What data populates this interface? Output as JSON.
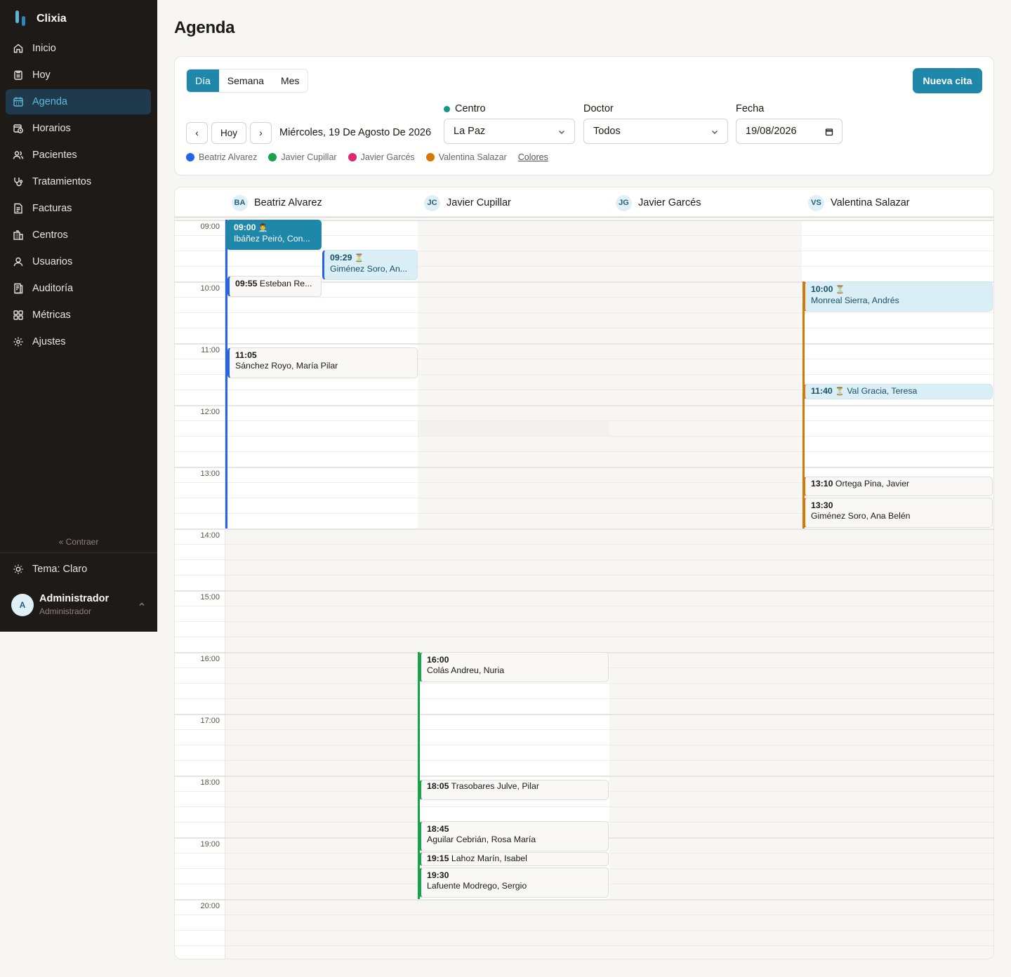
{
  "app": {
    "name": "Clixia"
  },
  "sidebar": {
    "items": [
      {
        "label": "Inicio",
        "icon": "home-icon"
      },
      {
        "label": "Hoy",
        "icon": "clipboard-icon"
      },
      {
        "label": "Agenda",
        "icon": "calendar-icon",
        "active": true
      },
      {
        "label": "Horarios",
        "icon": "schedule-icon"
      },
      {
        "label": "Pacientes",
        "icon": "users-icon"
      },
      {
        "label": "Tratamientos",
        "icon": "stethoscope-icon"
      },
      {
        "label": "Facturas",
        "icon": "invoice-icon"
      },
      {
        "label": "Centros",
        "icon": "building-icon"
      },
      {
        "label": "Usuarios",
        "icon": "user-icon"
      },
      {
        "label": "Auditoría",
        "icon": "audit-icon"
      },
      {
        "label": "Métricas",
        "icon": "grid-icon"
      },
      {
        "label": "Ajustes",
        "icon": "gear-icon"
      }
    ],
    "collapse_label": "« Contraer",
    "theme_label": "Tema: Claro",
    "user": {
      "initial": "A",
      "name": "Administrador",
      "role": "Administrador"
    }
  },
  "page": {
    "title": "Agenda"
  },
  "toolbar": {
    "views": [
      "Día",
      "Semana",
      "Mes"
    ],
    "active_view": "Día",
    "new_button": "Nueva cita",
    "prev": "‹",
    "today": "Hoy",
    "next": "›",
    "date_label": "Miércoles, 19 De Agosto De 2026",
    "centro": {
      "label": "Centro",
      "value": "La Paz"
    },
    "doctor": {
      "label": "Doctor",
      "value": "Todos"
    },
    "fecha": {
      "label": "Fecha",
      "value": "19/08/2026"
    },
    "legend": [
      {
        "name": "Beatriz Alvarez",
        "color": "#2563eb"
      },
      {
        "name": "Javier Cupillar",
        "color": "#16a34a"
      },
      {
        "name": "Javier Garcés",
        "color": "#db2777"
      },
      {
        "name": "Valentina Salazar",
        "color": "#d97706"
      }
    ],
    "colors_link": "Colores"
  },
  "calendar": {
    "doctors": [
      {
        "initials": "BA",
        "name": "Beatriz Alvarez"
      },
      {
        "initials": "JC",
        "name": "Javier Cupillar"
      },
      {
        "initials": "JG",
        "name": "Javier Garcés"
      },
      {
        "initials": "VS",
        "name": "Valentina Salazar"
      }
    ],
    "hours": [
      "09:00",
      "10:00",
      "11:00",
      "12:00",
      "13:00",
      "14:00",
      "15:00",
      "16:00",
      "17:00",
      "18:00",
      "19:00",
      "20:00"
    ],
    "appointments": [
      {
        "doctor": 0,
        "time": "09:00",
        "badge": "👨‍⚕️",
        "name": "Ibáñez Peiró, Con...",
        "status": "confirmed"
      },
      {
        "doctor": 0,
        "time": "09:29",
        "badge": "⏳",
        "name": "Giménez Soro, An...",
        "status": "pending"
      },
      {
        "doctor": 0,
        "time": "09:55",
        "name": "Esteban Re...",
        "status": "normal"
      },
      {
        "doctor": 0,
        "time": "11:05",
        "name": "Sánchez Royo, María Pilar",
        "status": "normal"
      },
      {
        "doctor": 3,
        "time": "10:00",
        "badge": "⏳",
        "name": "Monreal Sierra, Andrés",
        "status": "pending"
      },
      {
        "doctor": 3,
        "time": "11:40",
        "badge": "⏳",
        "name": "Val Gracia, Teresa",
        "status": "pending"
      },
      {
        "doctor": 3,
        "time": "13:10",
        "name": "Ortega Pina, Javier",
        "status": "normal"
      },
      {
        "doctor": 3,
        "time": "13:30",
        "name": "Giménez Soro, Ana Belén",
        "status": "normal"
      },
      {
        "doctor": 1,
        "time": "16:00",
        "name": "Colás Andreu, Nuria",
        "status": "normal"
      },
      {
        "doctor": 1,
        "time": "18:05",
        "name": "Trasobares Julve, Pilar",
        "status": "normal"
      },
      {
        "doctor": 1,
        "time": "18:45",
        "name": "Aguilar Cebrián, Rosa María",
        "status": "normal"
      },
      {
        "doctor": 1,
        "time": "19:15",
        "name": "Lahoz Marín, Isabel",
        "status": "normal"
      },
      {
        "doctor": 1,
        "time": "19:30",
        "name": "Lafuente Modrego, Sergio",
        "status": "normal"
      }
    ]
  },
  "colors": {
    "accent": "#1f87aa",
    "sidebar_bg": "#1e1a17"
  }
}
